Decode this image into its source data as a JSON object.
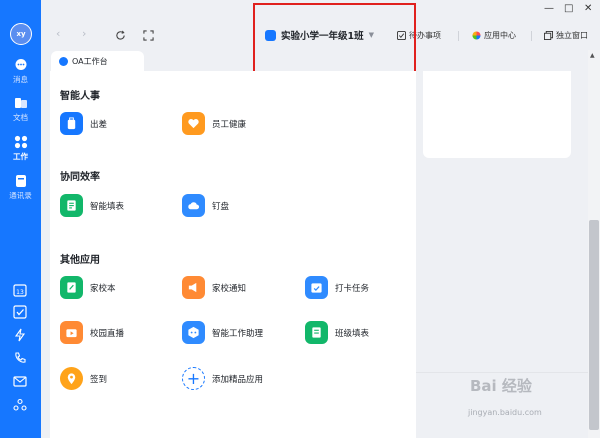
{
  "colors": {
    "sidebar": "#1677ff",
    "accent": "#1677ff",
    "highlight": "#e0201d"
  },
  "sidebar": {
    "avatar": "xy",
    "items": [
      {
        "label": "消息",
        "icon": "chat-icon"
      },
      {
        "label": "文档",
        "icon": "docs-icon"
      },
      {
        "label": "工作",
        "icon": "grid-icon",
        "active": true
      },
      {
        "label": "通讯录",
        "icon": "contacts-icon"
      }
    ],
    "bottom_icons": [
      "calendar-icon",
      "todo-check-icon",
      "lightning-icon",
      "phone-icon",
      "mail-icon",
      "recycle-icon"
    ],
    "calendar_day": "13"
  },
  "topbar": {
    "org_name": "实验小学一年级1班",
    "links": [
      {
        "label": "待办事项",
        "icon": "todo-icon"
      },
      {
        "label": "应用中心",
        "icon": "app-center-icon"
      },
      {
        "label": "独立窗口",
        "icon": "window-icon"
      }
    ]
  },
  "tab": {
    "label": "OA工作台"
  },
  "sections": [
    {
      "title": "智能人事",
      "apps": [
        {
          "label": "出差",
          "color": "#1677ff"
        },
        {
          "label": "员工健康",
          "color": "#ff9a1f"
        }
      ]
    },
    {
      "title": "协同效率",
      "apps": [
        {
          "label": "智能填表",
          "color": "#12b76a"
        },
        {
          "label": "钉盘",
          "color": "#2f8bff"
        }
      ]
    },
    {
      "title": "其他应用",
      "apps": [
        {
          "label": "家校本",
          "color": "#12b76a"
        },
        {
          "label": "家校通知",
          "color": "#ff8a34"
        },
        {
          "label": "打卡任务",
          "color": "#2f8bff"
        },
        {
          "label": "校园直播",
          "color": "#ff8a34"
        },
        {
          "label": "智能工作助理",
          "color": "#2f8bff"
        },
        {
          "label": "班级填表",
          "color": "#12b76a"
        },
        {
          "label": "签到",
          "color": "#ffa31a"
        },
        {
          "label": "添加精品应用",
          "color": "#1677ff"
        }
      ]
    }
  ],
  "watermark": {
    "main": "Bai 经验",
    "sub": "jingyan.baidu.com"
  }
}
